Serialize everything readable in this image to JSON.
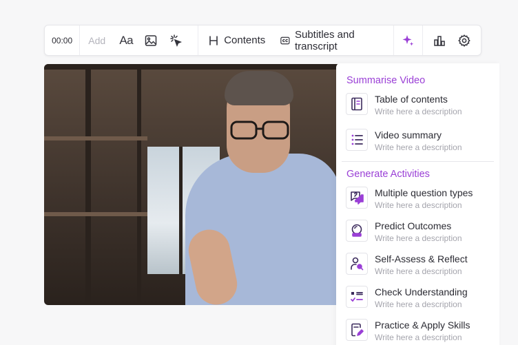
{
  "toolbar": {
    "time": "00:00",
    "add_label": "Add",
    "text_tool_icon": "Aa",
    "contents_label": "Contents",
    "subtitles_label": "Subtitles and transcript"
  },
  "colors": {
    "accent": "#9a3fd6",
    "accent_dark": "#3b2a5c"
  },
  "panel": {
    "summarise": {
      "title": "Summarise Video",
      "items": [
        {
          "icon": "book-icon",
          "title": "Table of contents",
          "description": "Write here a description"
        },
        {
          "icon": "list-icon",
          "title": "Video summary",
          "description": "Write here a description"
        }
      ]
    },
    "activities": {
      "title": "Generate Activities",
      "items": [
        {
          "icon": "question-chat-icon",
          "title": "Multiple question types",
          "description": "Write here a description"
        },
        {
          "icon": "crystal-ball-icon",
          "title": "Predict Outcomes",
          "description": "Write here a description"
        },
        {
          "icon": "person-search-icon",
          "title": "Self-Assess & Reflect",
          "description": "Write here a description"
        },
        {
          "icon": "checklist-icon",
          "title": "Check Understanding",
          "description": "Write here a description"
        },
        {
          "icon": "edit-doc-icon",
          "title": "Practice & Apply Skills",
          "description": "Write here a description"
        }
      ]
    }
  }
}
